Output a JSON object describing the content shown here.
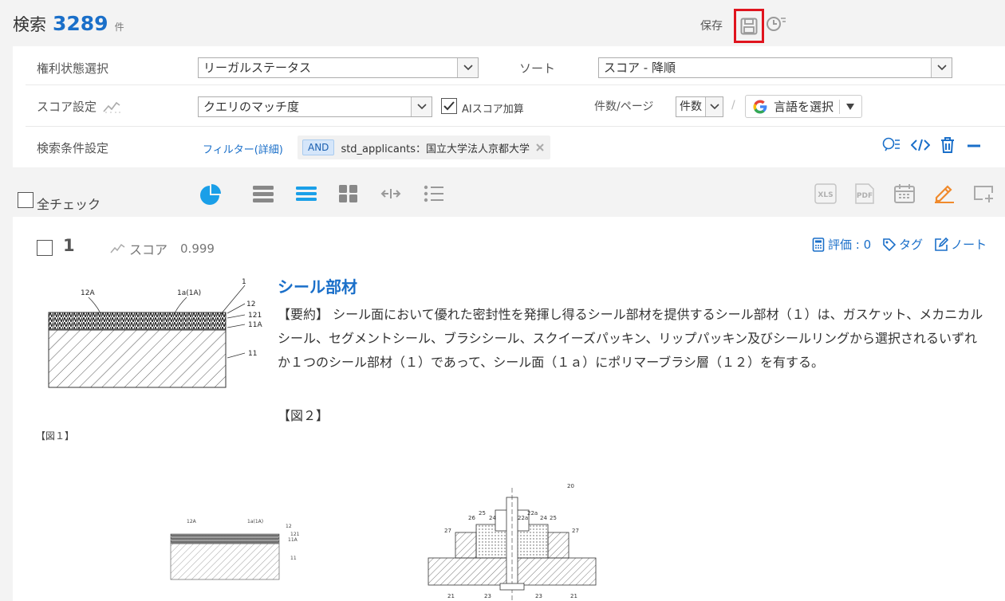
{
  "header": {
    "title": "検索",
    "count": "3289",
    "count_unit": "件",
    "save_label": "保存"
  },
  "filters": {
    "rights_status_label": "権利状態選択",
    "rights_status_value": "リーガルステータス",
    "sort_label": "ソート",
    "sort_value": "スコア - 降順",
    "score_label": "スコア設定",
    "score_value": "クエリのマッチ度",
    "ai_score_label": "AIスコア加算",
    "per_page_label": "件数/ページ",
    "per_page_value": "件数",
    "separator": "/",
    "translate_label": "言語を選択",
    "conditions_label": "検索条件設定",
    "filter_detail_label": "フィルター(詳細)",
    "and_badge": "AND",
    "condition_text": "std_applicants：国立大学法人京都大学"
  },
  "toolbar": {
    "check_all_label": "全チェック",
    "xls_label": "XLS",
    "pdf_label": "PDF"
  },
  "result": {
    "index": "1",
    "score_label": "スコア",
    "score_value": "0.999",
    "rating_label": "評価 : 0",
    "tag_label": "タグ",
    "note_label": "ノート",
    "title": "シール部材",
    "abstract": "【要約】 シール面において優れた密封性を発揮し得るシール部材を提供するシール部材（１）は、ガスケット、メカニカルシール、セグメントシール、ブラシシール、スクイーズパッキン、リップパッキン及びシールリングから選択されるいずれか１つのシール部材（１）であって、シール面（１ａ）にポリマーブラシ層（１２）を有する。",
    "fig_ref2": "【図２】",
    "fig_caption1": "【図１】",
    "fig1_labels": {
      "a": "12A",
      "b": "1a(1A)",
      "c": "1",
      "d": "12",
      "e": "121",
      "f": "11A",
      "g": "11"
    },
    "fig2_labels": {
      "a": "20",
      "b": "25",
      "c": "26",
      "d": "24",
      "e": "22a",
      "f": "22a",
      "g": "24",
      "h": "25",
      "i": "27",
      "j": "27",
      "k": "21",
      "l": "23",
      "m": "23",
      "n": "21"
    }
  },
  "colors": {
    "accent": "#1a6fc9",
    "highlight": "#e0141e",
    "edit_icon": "#f08a2c"
  }
}
